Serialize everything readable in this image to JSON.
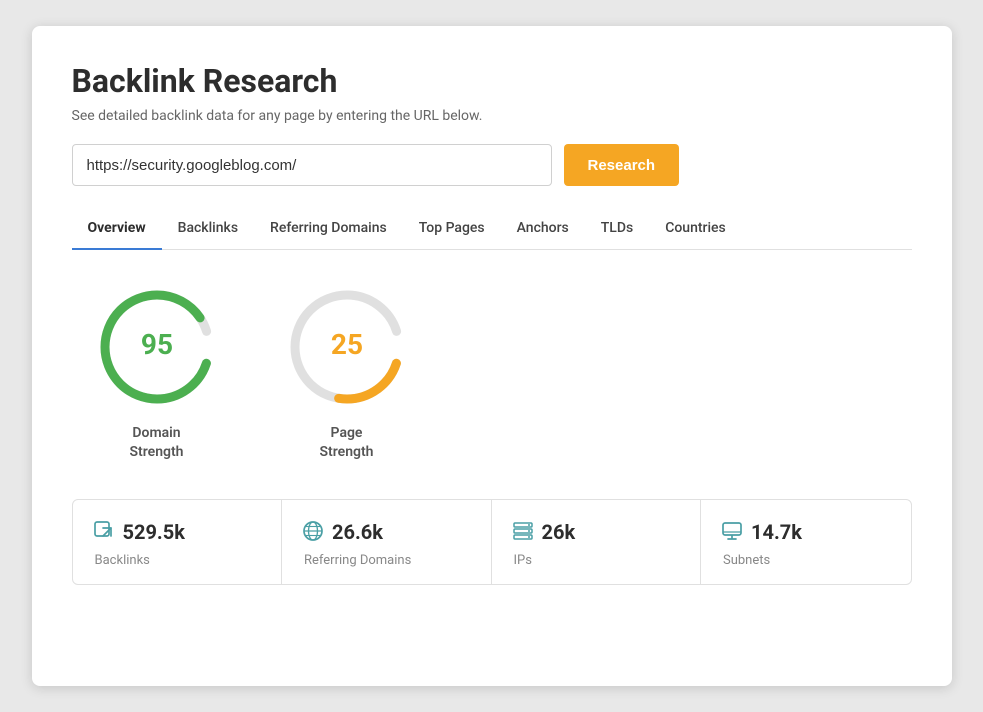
{
  "page": {
    "title": "Backlink Research",
    "subtitle": "See detailed backlink data for any page by entering the URL below.",
    "search": {
      "placeholder": "",
      "value": "https://security.googleblog.com/",
      "button_label": "Research"
    },
    "tabs": [
      {
        "id": "overview",
        "label": "Overview",
        "active": true
      },
      {
        "id": "backlinks",
        "label": "Backlinks",
        "active": false
      },
      {
        "id": "referring-domains",
        "label": "Referring Domains",
        "active": false
      },
      {
        "id": "top-pages",
        "label": "Top Pages",
        "active": false
      },
      {
        "id": "anchors",
        "label": "Anchors",
        "active": false
      },
      {
        "id": "tlds",
        "label": "TLDs",
        "active": false
      },
      {
        "id": "countries",
        "label": "Countries",
        "active": false
      }
    ],
    "gauges": [
      {
        "id": "domain-strength",
        "value": 95,
        "max": 100,
        "color": "#4caf50",
        "track_color": "#e0e0e0",
        "label": "Domain\nStrength",
        "label_color": "#4caf50"
      },
      {
        "id": "page-strength",
        "value": 25,
        "max": 100,
        "color": "#f5a623",
        "track_color": "#e0e0e0",
        "label": "Page\nStrength",
        "label_color": "#f5a623"
      }
    ],
    "stats": [
      {
        "id": "backlinks",
        "icon": "backlinks-icon",
        "icon_symbol": "↗",
        "value": "529.5k",
        "label": "Backlinks"
      },
      {
        "id": "referring-domains",
        "icon": "globe-icon",
        "icon_symbol": "🌐",
        "value": "26.6k",
        "label": "Referring Domains"
      },
      {
        "id": "ips",
        "icon": "server-icon",
        "icon_symbol": "▤",
        "value": "26k",
        "label": "IPs"
      },
      {
        "id": "subnets",
        "icon": "monitor-icon",
        "icon_symbol": "▣",
        "value": "14.7k",
        "label": "Subnets"
      }
    ]
  }
}
